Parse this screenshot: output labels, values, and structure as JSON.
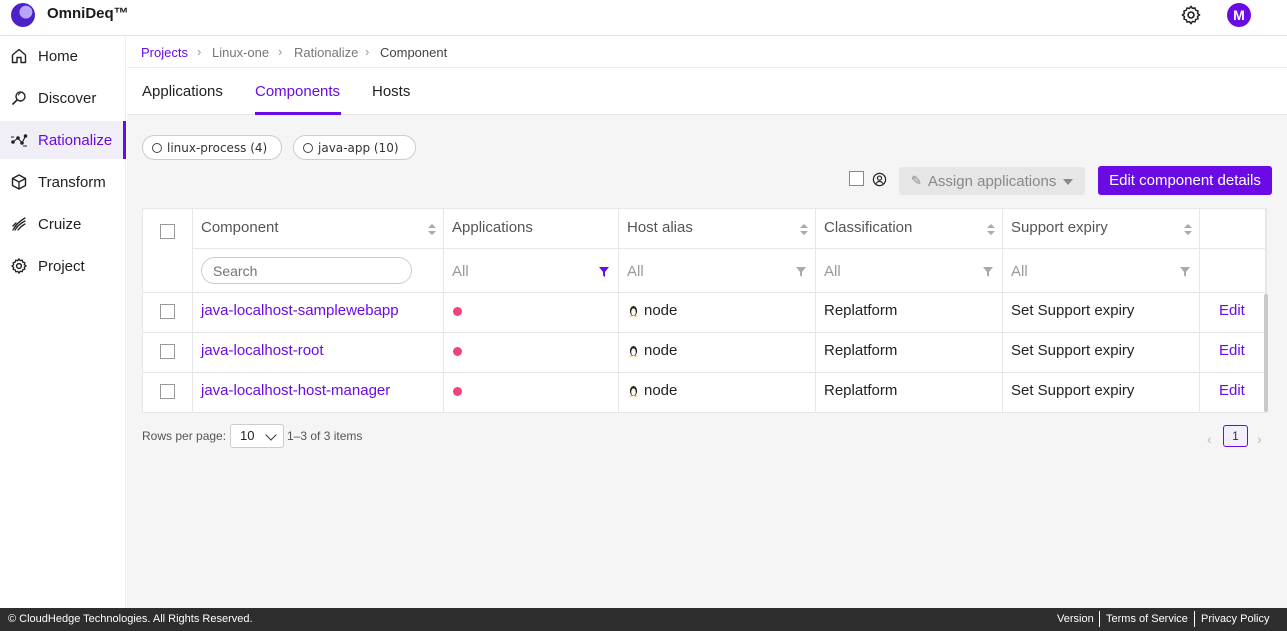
{
  "app": {
    "brand": "OmniDeq™",
    "avatar_letter": "M"
  },
  "sidebar": {
    "items": [
      {
        "label": "Home",
        "icon": "home-icon"
      },
      {
        "label": "Discover",
        "icon": "discover-icon"
      },
      {
        "label": "Rationalize",
        "icon": "rationalize-icon",
        "active": true
      },
      {
        "label": "Transform",
        "icon": "cube-icon"
      },
      {
        "label": "Cruize",
        "icon": "cruize-icon"
      },
      {
        "label": "Project",
        "icon": "gear-icon"
      }
    ]
  },
  "breadcrumb": [
    "Projects",
    "Linux-one",
    "Rationalize",
    "Component"
  ],
  "tabs": [
    {
      "label": "Applications"
    },
    {
      "label": "Components",
      "active": true
    },
    {
      "label": "Hosts"
    }
  ],
  "chips": [
    {
      "label": "linux-process (4)"
    },
    {
      "label": "java-app (10)"
    }
  ],
  "toolbar": {
    "assign_label": "Assign applications",
    "edit_details_label": "Edit component details"
  },
  "table": {
    "columns": [
      "Component",
      "Applications",
      "Host alias",
      "Classification",
      "Support expiry"
    ],
    "search_placeholder": "Search",
    "filters": [
      "All",
      "All",
      "All",
      "All"
    ],
    "rows": [
      {
        "component": "java-localhost-samplewebapp",
        "host": "node",
        "classification": "Replatform",
        "support": "Set Support expiry",
        "action": "Edit"
      },
      {
        "component": "java-localhost-root",
        "host": "node",
        "classification": "Replatform",
        "support": "Set Support expiry",
        "action": "Edit"
      },
      {
        "component": "java-localhost-host-manager",
        "host": "node",
        "classification": "Replatform",
        "support": "Set Support expiry",
        "action": "Edit"
      }
    ]
  },
  "pagination": {
    "rows_per_page_label": "Rows per page:",
    "rows_per_page": "10",
    "items_text": "1–3 of 3 items",
    "current_page": "1"
  },
  "footer": {
    "copyright": "© CloudHedge Technologies. All Rights Reserved.",
    "links": [
      "Version",
      "Terms of Service",
      "Privacy Policy"
    ]
  },
  "colors": {
    "accent": "#6a0be6",
    "status_dot": "#f0437c",
    "footer_bg": "#2e2e2e"
  }
}
